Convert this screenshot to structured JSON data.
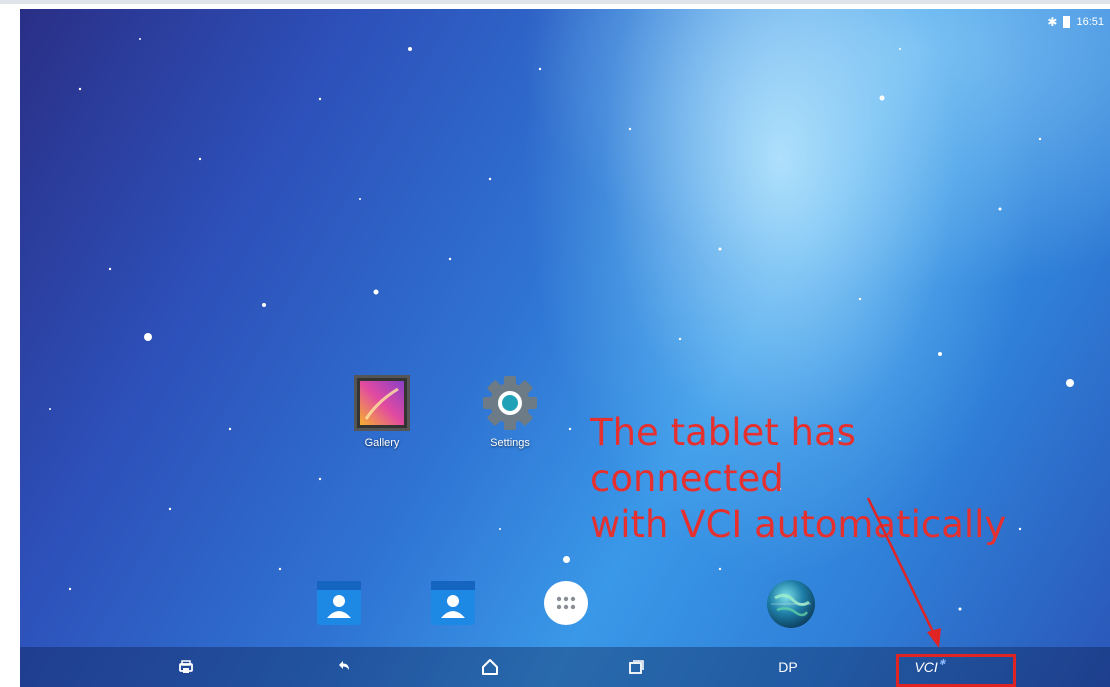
{
  "status_bar": {
    "time": "16:51",
    "bluetooth_icon": "bluetooth-icon",
    "battery_icon": "battery-icon"
  },
  "apps": [
    {
      "label": "Gallery",
      "icon": "gallery-icon"
    },
    {
      "label": "Settings",
      "icon": "settings-gear-icon"
    }
  ],
  "dock": [
    {
      "icon": "contacts-icon"
    },
    {
      "icon": "contacts-icon"
    },
    {
      "icon": "app-drawer-icon"
    },
    {
      "icon": "globe-browser-icon"
    }
  ],
  "nav_bar": {
    "buttons": [
      {
        "icon": "print-icon"
      },
      {
        "icon": "back-icon"
      },
      {
        "icon": "home-icon"
      },
      {
        "icon": "recents-icon"
      }
    ],
    "dp_label": "DP",
    "vci_label": "VCI"
  },
  "annotation": {
    "line1": "The tablet has connected",
    "line2": "with VCI automatically",
    "color": "#e5302f"
  }
}
